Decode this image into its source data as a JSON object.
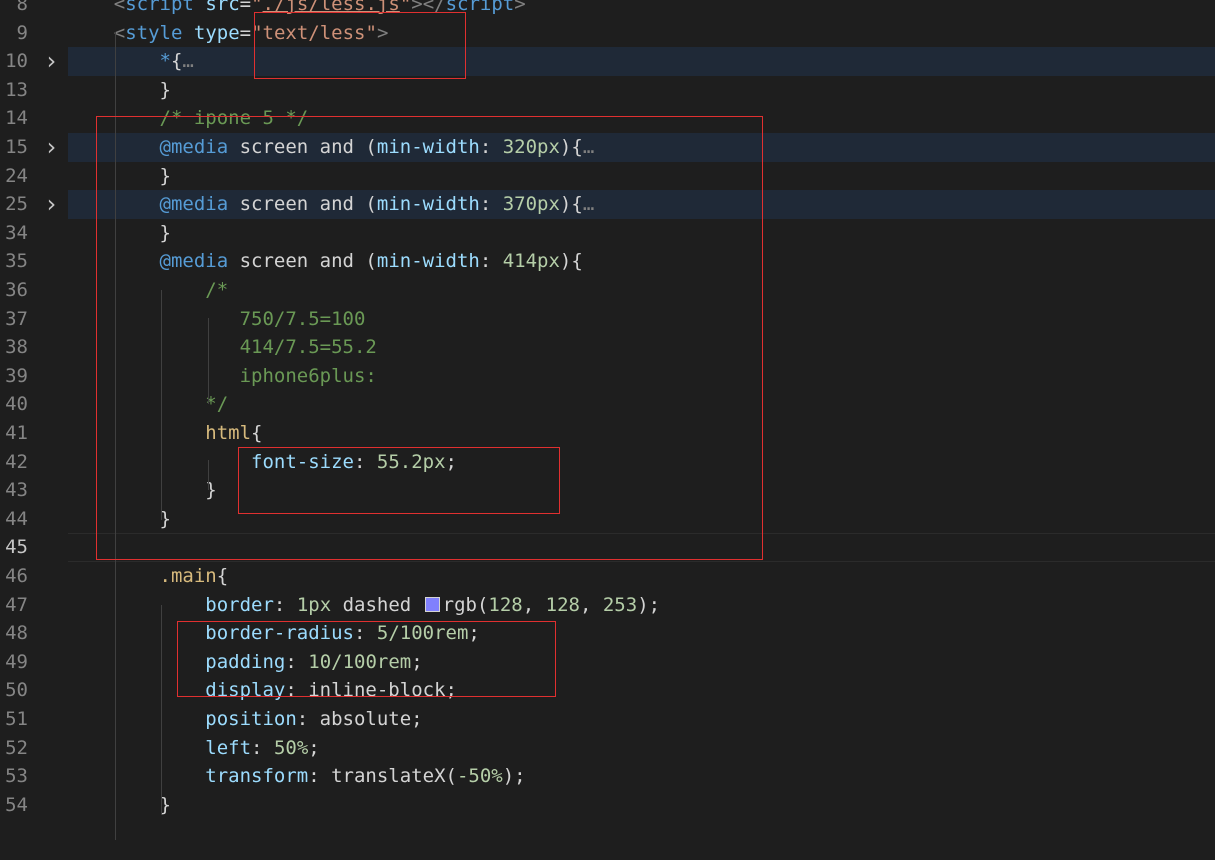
{
  "lines": [
    {
      "n": "8",
      "fold": false,
      "hl": false,
      "indent": 0,
      "tokens": [
        [
          "    ",
          "t-plain"
        ],
        [
          "<",
          "t-tag"
        ],
        [
          "script",
          "t-tn"
        ],
        [
          " ",
          "t-plain"
        ],
        [
          "src",
          "t-attr"
        ],
        [
          "=",
          "t-plain"
        ],
        [
          "\"",
          "t-str"
        ],
        [
          "./js/less.js",
          "t-str-u"
        ],
        [
          "\"",
          "t-str"
        ],
        [
          "></",
          "t-tag"
        ],
        [
          "script",
          "t-tn"
        ],
        [
          ">",
          "t-tag"
        ]
      ]
    },
    {
      "n": "9",
      "fold": false,
      "hl": false,
      "tokens": [
        [
          "    ",
          "t-plain"
        ],
        [
          "<",
          "t-tag"
        ],
        [
          "style",
          "t-tn"
        ],
        [
          " ",
          "t-plain"
        ],
        [
          "type",
          "t-attr"
        ],
        [
          "=",
          "t-plain"
        ],
        [
          "\"text/less\"",
          "t-str"
        ],
        [
          ">",
          "t-tag"
        ]
      ]
    },
    {
      "n": "10",
      "fold": true,
      "hl": true,
      "tokens": [
        [
          "        ",
          "t-plain"
        ],
        [
          "*",
          "t-tn"
        ],
        [
          "{",
          "t-plain"
        ],
        [
          "…",
          "t-ell"
        ]
      ]
    },
    {
      "n": "13",
      "fold": false,
      "hl": false,
      "tokens": [
        [
          "        ",
          "t-plain"
        ],
        [
          "}",
          "t-plain"
        ]
      ]
    },
    {
      "n": "14",
      "fold": false,
      "hl": false,
      "tokens": [
        [
          "        ",
          "t-plain"
        ],
        [
          "/* ipone 5 */",
          "t-cmt"
        ]
      ]
    },
    {
      "n": "15",
      "fold": true,
      "hl": true,
      "tokens": [
        [
          "        ",
          "t-plain"
        ],
        [
          "@media",
          "t-at"
        ],
        [
          " screen and (",
          "t-plain"
        ],
        [
          "min-width",
          "t-prop"
        ],
        [
          ": ",
          "t-plain"
        ],
        [
          "320px",
          "t-num"
        ],
        [
          "){",
          "t-plain"
        ],
        [
          "…",
          "t-ell"
        ]
      ]
    },
    {
      "n": "24",
      "fold": false,
      "hl": false,
      "tokens": [
        [
          "        ",
          "t-plain"
        ],
        [
          "}",
          "t-plain"
        ]
      ]
    },
    {
      "n": "25",
      "fold": true,
      "hl": true,
      "tokens": [
        [
          "        ",
          "t-plain"
        ],
        [
          "@media",
          "t-at"
        ],
        [
          " screen and (",
          "t-plain"
        ],
        [
          "min-width",
          "t-prop"
        ],
        [
          ": ",
          "t-plain"
        ],
        [
          "370px",
          "t-num"
        ],
        [
          "){",
          "t-plain"
        ],
        [
          "…",
          "t-ell"
        ]
      ]
    },
    {
      "n": "34",
      "fold": false,
      "hl": false,
      "tokens": [
        [
          "        ",
          "t-plain"
        ],
        [
          "}",
          "t-plain"
        ]
      ]
    },
    {
      "n": "35",
      "fold": false,
      "hl": false,
      "tokens": [
        [
          "        ",
          "t-plain"
        ],
        [
          "@media",
          "t-at"
        ],
        [
          " screen and (",
          "t-plain"
        ],
        [
          "min-width",
          "t-prop"
        ],
        [
          ": ",
          "t-plain"
        ],
        [
          "414px",
          "t-num"
        ],
        [
          "){",
          "t-plain"
        ]
      ]
    },
    {
      "n": "36",
      "fold": false,
      "hl": false,
      "tokens": [
        [
          "            ",
          "t-plain"
        ],
        [
          "/*",
          "t-cmt"
        ]
      ]
    },
    {
      "n": "37",
      "fold": false,
      "hl": false,
      "tokens": [
        [
          "               ",
          "t-plain"
        ],
        [
          "750/7.5=100",
          "t-cmt"
        ]
      ]
    },
    {
      "n": "38",
      "fold": false,
      "hl": false,
      "tokens": [
        [
          "               ",
          "t-plain"
        ],
        [
          "414/7.5=55.2",
          "t-cmt"
        ]
      ]
    },
    {
      "n": "39",
      "fold": false,
      "hl": false,
      "tokens": [
        [
          "               ",
          "t-plain"
        ],
        [
          "iphone6plus:",
          "t-cmt"
        ]
      ]
    },
    {
      "n": "40",
      "fold": false,
      "hl": false,
      "tokens": [
        [
          "            ",
          "t-plain"
        ],
        [
          "*/",
          "t-cmt"
        ]
      ]
    },
    {
      "n": "41",
      "fold": false,
      "hl": false,
      "tokens": [
        [
          "            ",
          "t-plain"
        ],
        [
          "html",
          "t-sel"
        ],
        [
          "{",
          "t-plain"
        ]
      ]
    },
    {
      "n": "42",
      "fold": false,
      "hl": false,
      "tokens": [
        [
          "                ",
          "t-plain"
        ],
        [
          "font-size",
          "t-prop"
        ],
        [
          ": ",
          "t-plain"
        ],
        [
          "55.2px",
          "t-num"
        ],
        [
          ";",
          "t-plain"
        ]
      ]
    },
    {
      "n": "43",
      "fold": false,
      "hl": false,
      "tokens": [
        [
          "            ",
          "t-plain"
        ],
        [
          "}",
          "t-plain"
        ]
      ]
    },
    {
      "n": "44",
      "fold": false,
      "hl": false,
      "tokens": [
        [
          "        ",
          "t-plain"
        ],
        [
          "}",
          "t-plain"
        ]
      ]
    },
    {
      "n": "45",
      "fold": false,
      "hl": false,
      "active": true,
      "tokens": []
    },
    {
      "n": "46",
      "fold": false,
      "hl": false,
      "tokens": [
        [
          "        ",
          "t-plain"
        ],
        [
          ".main",
          "t-sel"
        ],
        [
          "{",
          "t-plain"
        ]
      ]
    },
    {
      "n": "47",
      "fold": false,
      "hl": false,
      "swatch": true,
      "tokens": [
        [
          "            ",
          "t-plain"
        ],
        [
          "border",
          "t-prop"
        ],
        [
          ": ",
          "t-plain"
        ],
        [
          "1px",
          "t-num"
        ],
        [
          " dashed ",
          "t-plain"
        ],
        [
          "SWATCH",
          "swatch"
        ],
        [
          "rgb(",
          "t-plain"
        ],
        [
          "128",
          "t-num"
        ],
        [
          ", ",
          "t-plain"
        ],
        [
          "128",
          "t-num"
        ],
        [
          ", ",
          "t-plain"
        ],
        [
          "253",
          "t-num"
        ],
        [
          ");",
          "t-plain"
        ]
      ]
    },
    {
      "n": "48",
      "fold": false,
      "hl": false,
      "tokens": [
        [
          "            ",
          "t-plain"
        ],
        [
          "border-radius",
          "t-prop"
        ],
        [
          ": ",
          "t-plain"
        ],
        [
          "5/100rem",
          "t-num"
        ],
        [
          ";",
          "t-plain"
        ]
      ]
    },
    {
      "n": "49",
      "fold": false,
      "hl": false,
      "tokens": [
        [
          "            ",
          "t-plain"
        ],
        [
          "padding",
          "t-prop"
        ],
        [
          ": ",
          "t-plain"
        ],
        [
          "10/100rem",
          "t-num"
        ],
        [
          ";",
          "t-plain"
        ]
      ]
    },
    {
      "n": "50",
      "fold": false,
      "hl": false,
      "tokens": [
        [
          "            ",
          "t-plain"
        ],
        [
          "display",
          "t-prop"
        ],
        [
          ": inline-block;",
          "t-plain"
        ]
      ]
    },
    {
      "n": "51",
      "fold": false,
      "hl": false,
      "tokens": [
        [
          "            ",
          "t-plain"
        ],
        [
          "position",
          "t-prop"
        ],
        [
          ": absolute;",
          "t-plain"
        ]
      ]
    },
    {
      "n": "52",
      "fold": false,
      "hl": false,
      "tokens": [
        [
          "            ",
          "t-plain"
        ],
        [
          "left",
          "t-prop"
        ],
        [
          ": ",
          "t-plain"
        ],
        [
          "50%",
          "t-num"
        ],
        [
          ";",
          "t-plain"
        ]
      ]
    },
    {
      "n": "53",
      "fold": false,
      "hl": false,
      "tokens": [
        [
          "            ",
          "t-plain"
        ],
        [
          "transform",
          "t-prop"
        ],
        [
          ": translateX(",
          "t-plain"
        ],
        [
          "-50%",
          "t-num"
        ],
        [
          ");",
          "t-plain"
        ]
      ]
    },
    {
      "n": "54",
      "fold": false,
      "hl": false,
      "tokens": [
        [
          "        ",
          "t-plain"
        ],
        [
          "}",
          "t-plain"
        ]
      ]
    }
  ],
  "icons": {
    "fold": "chevron-right-icon",
    "swatch": "color-swatch-icon"
  },
  "colors": {
    "annotation_box": "#e03030",
    "swatch": "#8080fd",
    "folded_line_bg": "#1f2937"
  }
}
